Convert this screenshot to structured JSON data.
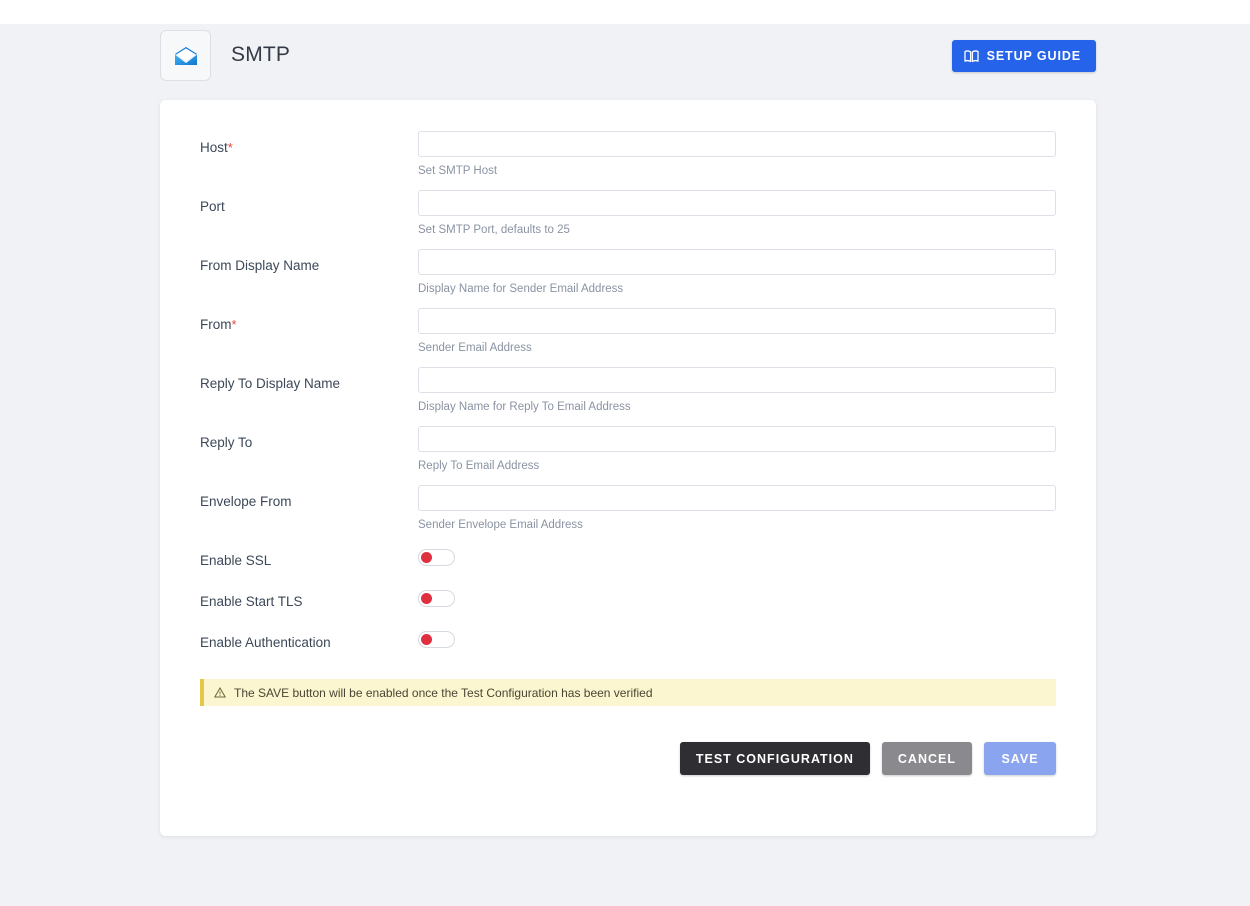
{
  "header": {
    "title": "SMTP",
    "app_icon": "envelope-icon",
    "setup_guide_label": "SETUP GUIDE",
    "setup_guide_icon": "book-icon",
    "setup_guide_color": "#2563eb"
  },
  "form": {
    "required_marker": "*",
    "fields": [
      {
        "label": "Host",
        "required": true,
        "value": "",
        "placeholder": "",
        "hint": "Set SMTP Host"
      },
      {
        "label": "Port",
        "required": false,
        "value": "",
        "placeholder": "",
        "hint": "Set SMTP Port, defaults to 25"
      },
      {
        "label": "From Display Name",
        "required": false,
        "value": "",
        "placeholder": "",
        "hint": "Display Name for Sender Email Address"
      },
      {
        "label": "From",
        "required": true,
        "value": "",
        "placeholder": "",
        "hint": "Sender Email Address"
      },
      {
        "label": "Reply To Display Name",
        "required": false,
        "value": "",
        "placeholder": "",
        "hint": "Display Name for Reply To Email Address"
      },
      {
        "label": "Reply To",
        "required": false,
        "value": "",
        "placeholder": "",
        "hint": "Reply To Email Address"
      },
      {
        "label": "Envelope From",
        "required": false,
        "value": "",
        "placeholder": "",
        "hint": "Sender Envelope Email Address"
      }
    ],
    "toggles": [
      {
        "label": "Enable SSL",
        "on": false
      },
      {
        "label": "Enable Start TLS",
        "on": false
      },
      {
        "label": "Enable Authentication",
        "on": false
      }
    ],
    "toggle_off_color": "#e03040"
  },
  "warning": {
    "icon": "warning-triangle-icon",
    "text": "The SAVE button will be enabled once the Test Configuration has been verified",
    "bg_color": "#fbf6cf",
    "accent_color": "#e3c64a"
  },
  "actions": {
    "test_label": "TEST CONFIGURATION",
    "cancel_label": "CANCEL",
    "save_label": "SAVE",
    "save_disabled": true
  }
}
